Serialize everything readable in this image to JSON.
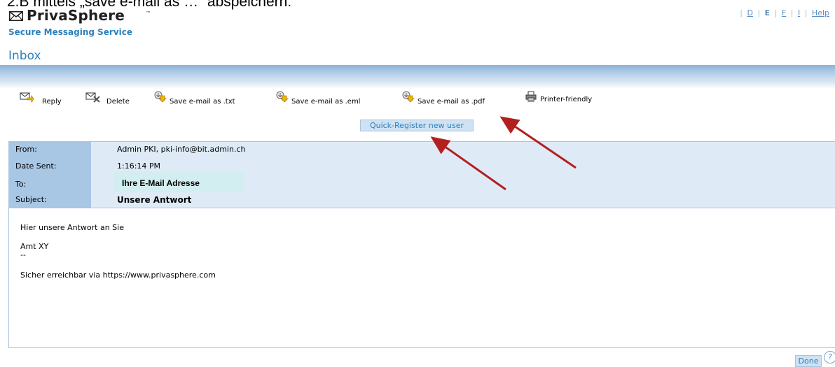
{
  "doc_caption": "2.B mittels „save e-mail as …“ abspeichern:",
  "branding": {
    "name": "PrivaSphere",
    "trademark": "™",
    "tagline": "Secure Messaging Service"
  },
  "language_bar": {
    "items": [
      {
        "label": "D",
        "active": false
      },
      {
        "label": "E",
        "active": true
      },
      {
        "label": "F",
        "active": false
      },
      {
        "label": "I",
        "active": false
      }
    ],
    "help": "Help"
  },
  "page_title": "Inbox",
  "toolbar": {
    "reply": "Reply",
    "delete": "Delete",
    "save_txt": "Save e-mail as .txt",
    "save_eml": "Save e-mail as .eml",
    "save_pdf": "Save e-mail as .pdf",
    "printer_friendly": "Printer-friendly"
  },
  "quick_register": "Quick-Register new user",
  "message": {
    "from_label": "From:",
    "from_value": "Admin PKI, pki-info@bit.admin.ch",
    "date_label": "Date Sent:",
    "date_value": "1:16:14 PM",
    "to_label": "To:",
    "to_value": "Ihre E-Mail Adresse",
    "subject_label": "Subject:",
    "subject_value": "Unsere Antwort",
    "body": {
      "line1": "Hier unsere Antwort an Sie",
      "line2": "Amt XY",
      "line3": "--",
      "line4": "Sicher erreichbar via https://www.privasphere.com"
    }
  },
  "footer": {
    "done": "Done",
    "help_glyph": "?"
  },
  "colors": {
    "accent": "#2c80ba",
    "header_bg": "#deebf7",
    "label_bg": "#a8c7e5",
    "annotation_arrow": "#b31f1f"
  }
}
